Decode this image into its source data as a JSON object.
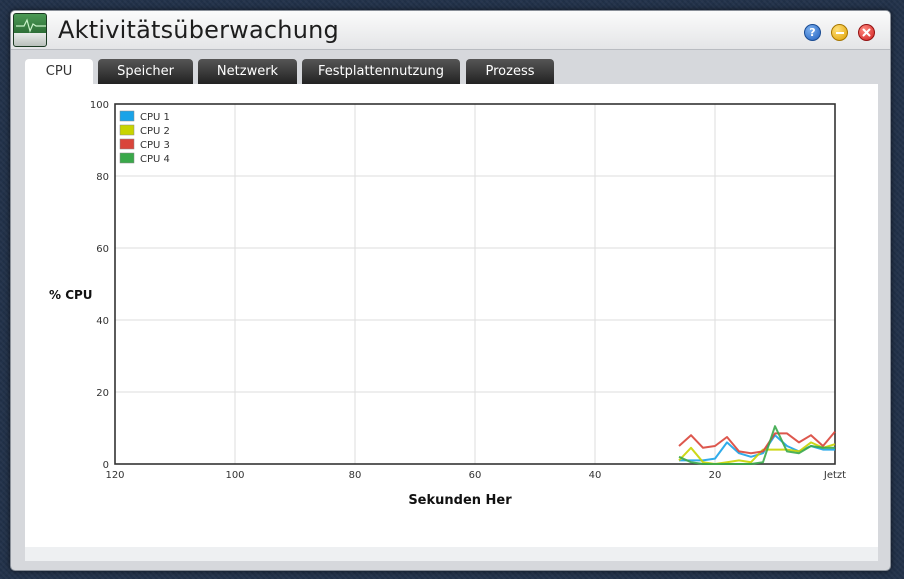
{
  "window": {
    "title": "Aktivitätsüberwachung",
    "help_label": "?"
  },
  "tabs": [
    {
      "label": "CPU",
      "active": true
    },
    {
      "label": "Speicher",
      "active": false
    },
    {
      "label": "Netzwerk",
      "active": false
    },
    {
      "label": "Festplattennutzung",
      "active": false
    },
    {
      "label": "Prozess",
      "active": false
    }
  ],
  "chart_data": {
    "type": "line",
    "ylabel": "% CPU",
    "xlabel": "Sekunden Her",
    "ylim": [
      0,
      100
    ],
    "y_ticks": [
      "0",
      "20",
      "40",
      "60",
      "80",
      "100"
    ],
    "x_ticks": [
      "120",
      "100",
      "80",
      "60",
      "40",
      "20",
      "Jetzt"
    ],
    "x_tick_values": [
      120,
      100,
      80,
      60,
      40,
      20,
      0
    ],
    "grid": true,
    "legend_position": "top-left",
    "x": [
      26,
      24,
      22,
      20,
      18,
      16,
      14,
      12,
      10,
      8,
      6,
      4,
      2,
      0
    ],
    "series": [
      {
        "name": "CPU 1",
        "color": "#1aa3e8",
        "values": [
          1,
          1,
          1,
          1.5,
          6,
          3,
          2,
          3,
          8,
          5,
          3.5,
          5,
          4,
          4
        ]
      },
      {
        "name": "CPU 2",
        "color": "#c8d400",
        "values": [
          1,
          4.5,
          0.5,
          0,
          0.5,
          1,
          0.5,
          4,
          4,
          4,
          3.5,
          6,
          4.5,
          5.5
        ]
      },
      {
        "name": "CPU 3",
        "color": "#d9453a",
        "values": [
          5,
          8,
          4.5,
          5,
          7.5,
          3.5,
          3,
          3.5,
          8.5,
          8.5,
          6,
          8,
          5,
          9
        ]
      },
      {
        "name": "CPU 4",
        "color": "#3aa84a",
        "values": [
          2,
          0.5,
          0,
          0,
          0,
          0,
          0,
          0.5,
          10.5,
          3.5,
          3,
          5,
          4.5,
          4.5
        ]
      }
    ]
  }
}
